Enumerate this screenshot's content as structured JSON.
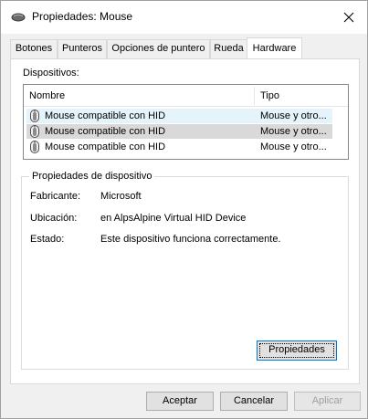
{
  "window": {
    "title": "Propiedades: Mouse",
    "close_glyph": "✕"
  },
  "tabs": [
    {
      "label": "Botones",
      "active": false
    },
    {
      "label": "Punteros",
      "active": false
    },
    {
      "label": "Opciones de puntero",
      "active": false
    },
    {
      "label": "Rueda",
      "active": false
    },
    {
      "label": "Hardware",
      "active": true
    }
  ],
  "devices": {
    "label": "Dispositivos:",
    "columns": {
      "name": "Nombre",
      "type": "Tipo"
    },
    "rows": [
      {
        "name": "Mouse compatible con HID",
        "type": "Mouse y otro...",
        "state": "hover"
      },
      {
        "name": "Mouse compatible con HID",
        "type": "Mouse y otro...",
        "state": "selected"
      },
      {
        "name": "Mouse compatible con HID",
        "type": "Mouse y otro...",
        "state": "normal"
      }
    ]
  },
  "properties": {
    "title": "Propiedades de dispositivo",
    "manufacturer_label": "Fabricante:",
    "manufacturer_value": "Microsoft",
    "location_label": "Ubicación:",
    "location_value": "en AlpsAlpine Virtual HID Device",
    "status_label": "Estado:",
    "status_value": "Este dispositivo funciona correctamente.",
    "properties_button": "Propiedades"
  },
  "footer": {
    "accept": "Aceptar",
    "cancel": "Cancelar",
    "apply": "Aplicar"
  },
  "colors": {
    "hover_row": "#e5f3fb",
    "selected_row": "#d9d9d9",
    "focus_border": "#0078d7"
  }
}
